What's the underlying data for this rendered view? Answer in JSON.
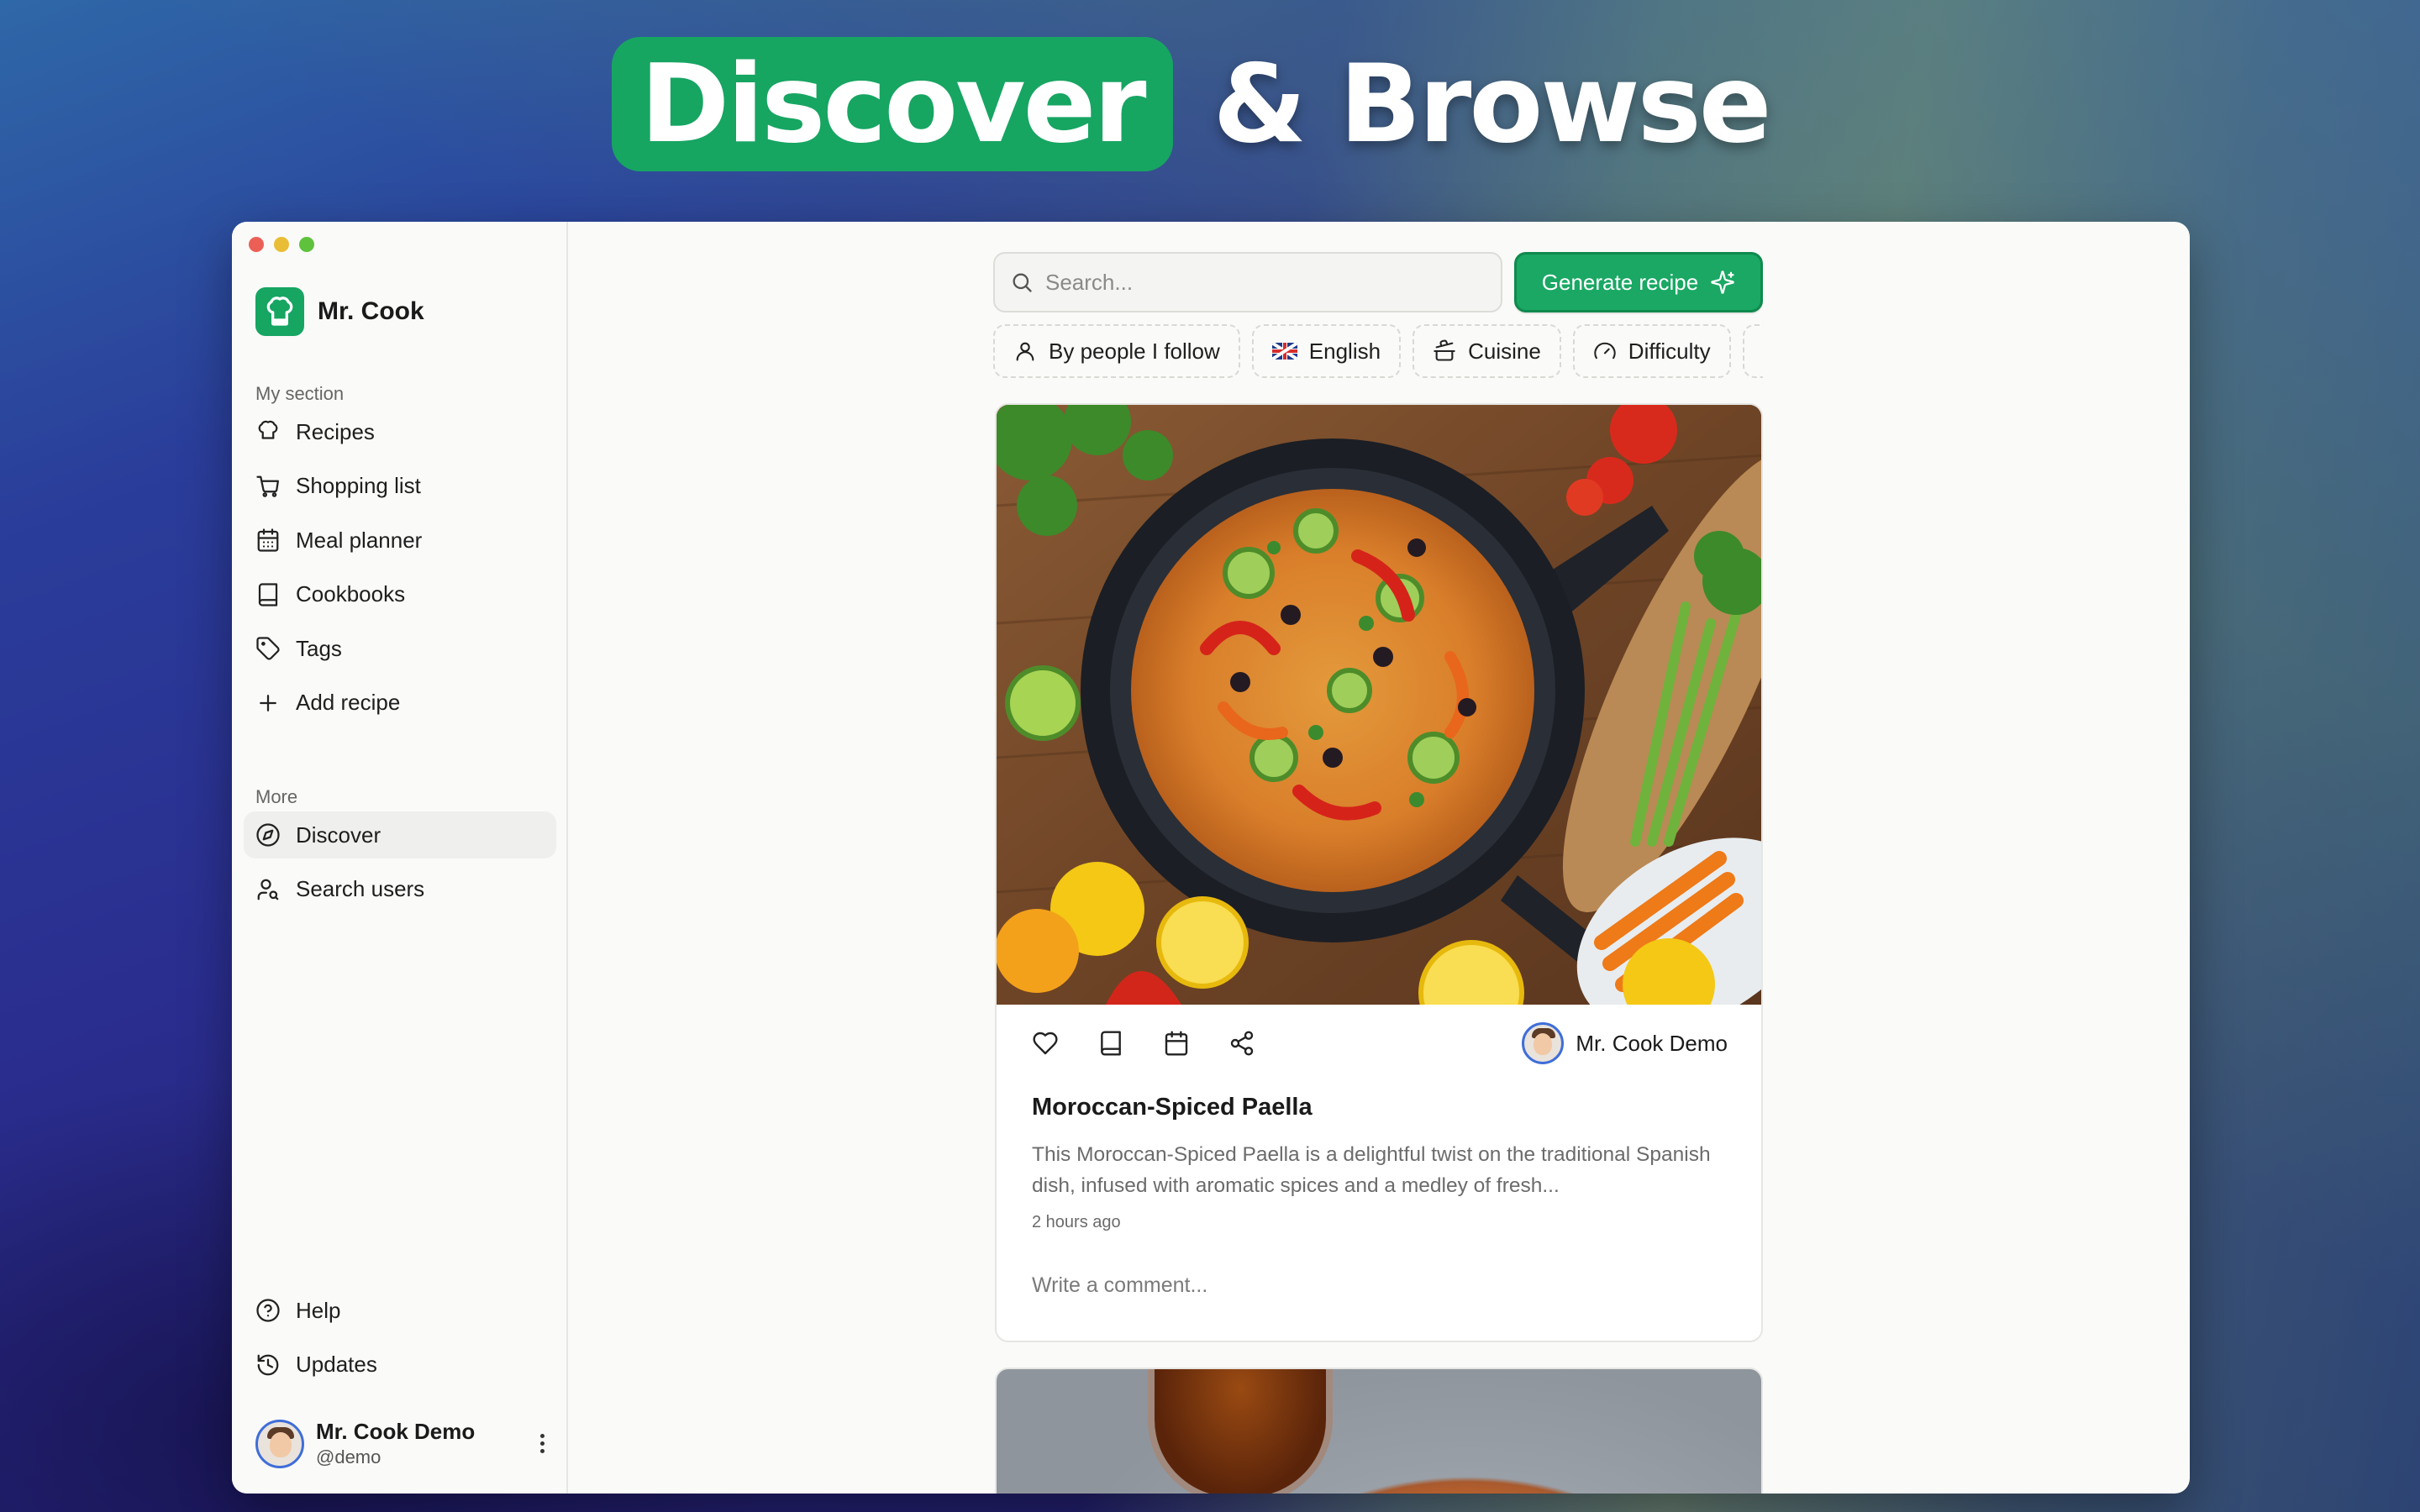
{
  "headline": {
    "highlight": "Discover",
    "rest": "& Browse"
  },
  "app": {
    "name": "Mr. Cook"
  },
  "sidebar": {
    "section_my": "My section",
    "my_items": [
      {
        "label": "Recipes",
        "icon": "chef-hat-icon"
      },
      {
        "label": "Shopping list",
        "icon": "cart-icon"
      },
      {
        "label": "Meal planner",
        "icon": "calendar-icon"
      },
      {
        "label": "Cookbooks",
        "icon": "book-icon"
      },
      {
        "label": "Tags",
        "icon": "tag-icon"
      },
      {
        "label": "Add recipe",
        "icon": "plus-icon"
      }
    ],
    "section_more": "More",
    "more_items": [
      {
        "label": "Discover",
        "icon": "compass-icon",
        "active": true
      },
      {
        "label": "Search users",
        "icon": "user-search-icon"
      }
    ],
    "footer_items": [
      {
        "label": "Help",
        "icon": "help-circle-icon"
      },
      {
        "label": "Updates",
        "icon": "history-icon"
      }
    ],
    "user": {
      "name": "Mr. Cook Demo",
      "handle": "@demo"
    }
  },
  "search": {
    "placeholder": "Search...",
    "value": ""
  },
  "generate_button": {
    "label": "Generate recipe"
  },
  "filters": [
    {
      "label": "By people I follow",
      "icon": "user-icon"
    },
    {
      "label": "English",
      "icon": "uk-flag-icon"
    },
    {
      "label": "Cuisine",
      "icon": "pot-icon"
    },
    {
      "label": "Difficulty",
      "icon": "gauge-icon"
    },
    {
      "label": "",
      "icon": "star-icon"
    }
  ],
  "feed": [
    {
      "title": "Moroccan-Spiced Paella",
      "description": "This Moroccan-Spiced Paella is a delightful twist on the traditional Spanish dish, infused with aromatic spices and a medley of fresh...",
      "time": "2 hours ago",
      "author": "Mr. Cook Demo",
      "comment_placeholder": "Write a comment..."
    }
  ],
  "colors": {
    "accent": "#17a562",
    "active_bg": "#efefed",
    "window_bg": "#fafaf8"
  }
}
